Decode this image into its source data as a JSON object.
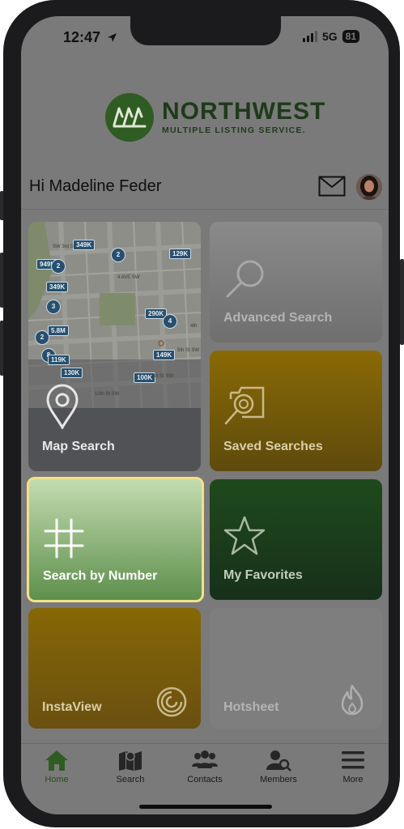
{
  "status_bar": {
    "time": "12:47",
    "network": "5G",
    "battery": "81"
  },
  "logo": {
    "title": "NORTHWEST",
    "subtitle": "MULTIPLE LISTING SERVICE."
  },
  "header": {
    "greeting": "Hi Madeline Feder"
  },
  "map_tile": {
    "label": "Map Search",
    "street_labels": [
      "4 AVE SW",
      "4th",
      "5th St SW",
      "10th St SW",
      "6th St SW",
      "SW 3rd St"
    ],
    "markers": [
      {
        "text": "349K"
      },
      {
        "text": "2"
      },
      {
        "text": "129K"
      },
      {
        "text": "949K"
      },
      {
        "text": "2"
      },
      {
        "text": "349K"
      },
      {
        "text": "3"
      },
      {
        "text": "290K"
      },
      {
        "text": "4"
      },
      {
        "text": "2"
      },
      {
        "text": "5.8M"
      },
      {
        "text": "8"
      },
      {
        "text": "119K"
      },
      {
        "text": "130K"
      },
      {
        "text": "149K"
      },
      {
        "text": "100K"
      }
    ]
  },
  "tiles": {
    "advanced_search": "Advanced Search",
    "saved_searches": "Saved Searches",
    "search_by_number": "Search by Number",
    "my_favorites": "My Favorites",
    "instaview": "InstaView",
    "hotsheet": "Hotsheet"
  },
  "tab_bar": {
    "home": "Home",
    "search": "Search",
    "contacts": "Contacts",
    "members": "Members",
    "more": "More"
  },
  "colors": {
    "logo_green": "#2f5c22",
    "gold_tile": "#8a6a06",
    "green_tile": "#1e3a1a",
    "highlight_border": "#f3e08a"
  }
}
